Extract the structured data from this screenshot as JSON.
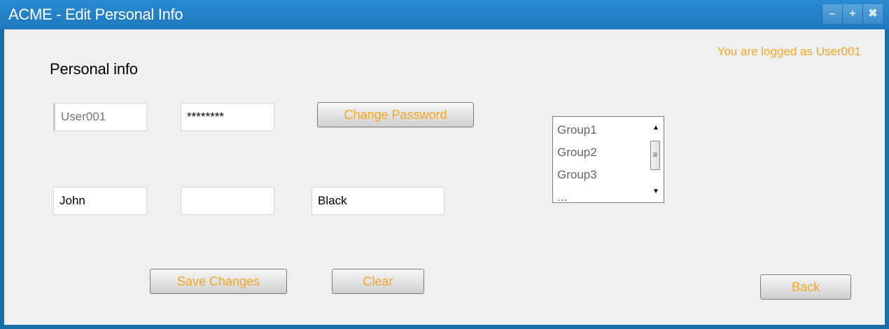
{
  "window": {
    "title": "ACME - Edit Personal Info",
    "controls": {
      "minimize": "–",
      "maximize": "+",
      "close": "✖"
    }
  },
  "status": {
    "logged_as": "You are logged as User001"
  },
  "form": {
    "heading": "Personal info",
    "username": "User001",
    "password": "********",
    "first_name": "John",
    "middle_name": "",
    "last_name": "Black"
  },
  "buttons": {
    "change_password": "Change Password",
    "save_changes": "Save Changes",
    "clear": "Clear",
    "back": "Back"
  },
  "groups": {
    "items": [
      "Group1",
      "Group2",
      "Group3",
      "..."
    ]
  },
  "colors": {
    "accent": "#f5a623",
    "titlebar": "#1f78bd"
  }
}
